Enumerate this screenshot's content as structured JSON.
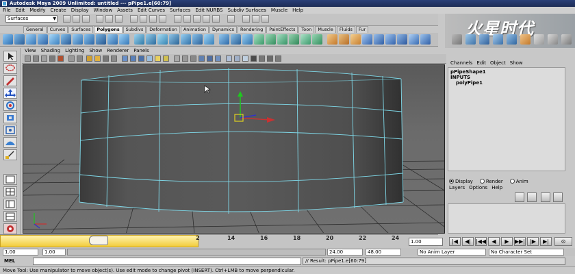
{
  "window": {
    "title": "Autodesk Maya 2009 Unlimited: untitled   ---   pPipe1.e[60:79]"
  },
  "menubar": {
    "items": [
      "File",
      "Edit",
      "Modify",
      "Create",
      "Display",
      "Window",
      "Assets",
      "Edit Curves",
      "Surfaces",
      "Edit NURBS",
      "Subdiv Surfaces",
      "Muscle",
      "Help"
    ]
  },
  "status_line": {
    "menu_set": "Surfaces"
  },
  "shelf": {
    "tabs": [
      "General",
      "Curves",
      "Surfaces",
      "Polygons",
      "Subdivs",
      "Deformation",
      "Animation",
      "Dynamics",
      "Rendering",
      "PaintEffects",
      "Toon",
      "Muscle",
      "Fluids",
      "Fur"
    ],
    "active_tab": "Polygons"
  },
  "panel": {
    "menu": [
      "View",
      "Shading",
      "Lighting",
      "Show",
      "Renderer",
      "Panels"
    ]
  },
  "channel_box": {
    "menu": [
      "Channels",
      "Edit",
      "Object",
      "Show"
    ],
    "node": "pPipeShape1",
    "inputs_label": "INPUTS",
    "inputs": [
      "polyPipe1"
    ]
  },
  "layer_editor": {
    "modes": [
      {
        "label": "Display",
        "selected": true
      },
      {
        "label": "Render",
        "selected": false
      },
      {
        "label": "Anim",
        "selected": false
      }
    ],
    "menu": [
      "Layers",
      "Options",
      "Help"
    ]
  },
  "time_slider": {
    "ticks": [
      "2",
      "14",
      "16",
      "18",
      "20",
      "22",
      "24"
    ],
    "current_frame": "1.00"
  },
  "range_slider": {
    "start_time": "1.00",
    "playback_start": "1.00",
    "playback_end": "24.00",
    "end_time": "48.00",
    "anim_layer": "No Anim Layer",
    "character_set": "No Character Set"
  },
  "command_line": {
    "label": "MEL",
    "result": "// Result: pPipe1.e[60:79]"
  },
  "help_line": {
    "text": "Move Tool: Use manipulator to move object(s). Use edit mode to change pivot (INSERT). Ctrl+LMB to move perpendicular."
  },
  "colors": {
    "wireframe": "#7fd8e8",
    "viewport_bg": "#606060",
    "grid": "#2a2a2a",
    "title_bar": "#2a3f77",
    "timeline_highlight": "#f2cc3a"
  }
}
